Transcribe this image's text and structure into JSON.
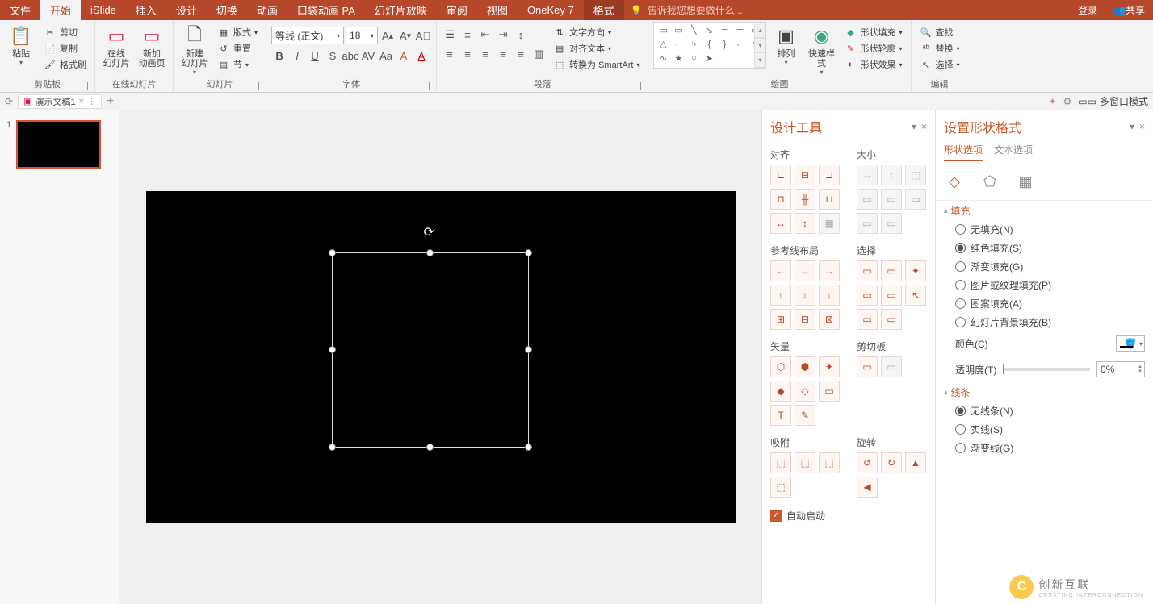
{
  "tabs": {
    "file": "文件",
    "home": "开始",
    "islide": "iSlide",
    "insert": "插入",
    "design": "设计",
    "transition": "切换",
    "animation": "动画",
    "pocket": "口袋动画 PA",
    "slideshow": "幻灯片放映",
    "review": "审阅",
    "view": "视图",
    "onekey": "OneKey 7",
    "format": "格式",
    "tellme": "告诉我您想要做什么...",
    "login": "登录",
    "share": "共享"
  },
  "ribbon": {
    "clipboard": {
      "paste": "粘贴",
      "cut": "剪切",
      "copy": "复制",
      "painter": "格式刷",
      "label": "剪贴板"
    },
    "onlineslides": {
      "online": "在线\n幻灯片",
      "new": "新加\n动画页",
      "label": "在线幻灯片"
    },
    "slides": {
      "new": "新建\n幻灯片",
      "layout": "版式",
      "reset": "重置",
      "section": "节",
      "label": "幻灯片"
    },
    "font": {
      "name": "等线 (正文)",
      "size": "18",
      "label": "字体"
    },
    "paragraph": {
      "textdir": "文字方向",
      "align": "对齐文本",
      "smartart": "转换为 SmartArt",
      "label": "段落"
    },
    "drawing": {
      "arrange": "排列",
      "quick": "快速样式",
      "fill": "形状填充",
      "outline": "形状轮廓",
      "effects": "形状效果",
      "label": "绘图"
    },
    "editing": {
      "find": "查找",
      "replace": "替换",
      "select": "选择",
      "label": "编辑"
    }
  },
  "docbar": {
    "name": "演示文稿1",
    "multiwin": "多窗口模式"
  },
  "designTools": {
    "title": "设计工具",
    "align": "对齐",
    "size": "大小",
    "guides": "参考线布局",
    "select": "选择",
    "vector": "矢量",
    "clipboard": "剪切板",
    "snap": "吸附",
    "rotate": "旋转",
    "autostart": "自动启动"
  },
  "shapeFormat": {
    "title": "设置形状格式",
    "tab_shape": "形状选项",
    "tab_text": "文本选项",
    "fill": {
      "title": "填充",
      "none": "无填充(N)",
      "solid": "纯色填充(S)",
      "gradient": "渐变填充(G)",
      "picture": "图片或纹理填充(P)",
      "pattern": "图案填充(A)",
      "slidebg": "幻灯片背景填充(B)",
      "color": "颜色(C)",
      "transparency": "透明度(T)",
      "pct": "0%"
    },
    "line": {
      "title": "线条",
      "none": "无线条(N)",
      "solid": "实线(S)",
      "gradient": "渐变线(G)"
    }
  },
  "watermark": {
    "name": "创新互联",
    "sub": "CREATING INTERCONNECTION"
  },
  "chart_data": null
}
